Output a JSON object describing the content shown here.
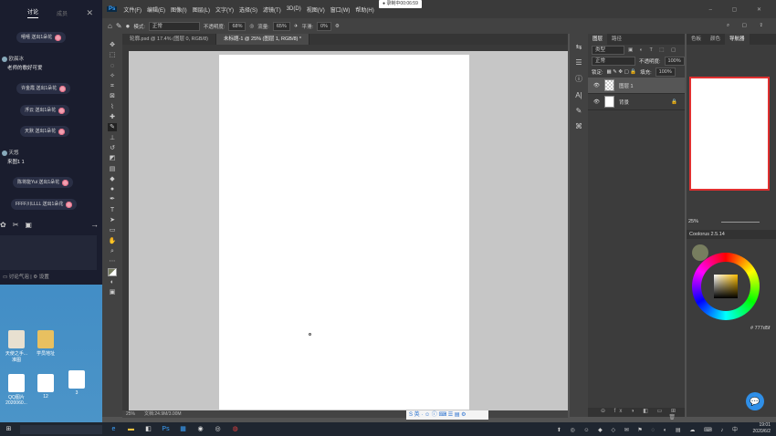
{
  "chat": {
    "tab_discuss": "讨论",
    "tab_members": "成员",
    "gifts": [
      "嘻嘻 送出1朵花",
      "许金霞 送出1朵花",
      "浮云 送出1朵花",
      "天默 送出1朵花",
      "陈将能Yui 送出1朵花",
      "FFFF川LLLL 送出1朵花"
    ],
    "msg1_user": "欧晨冰",
    "msg1_text": "老师的歌好可爱",
    "msg2_user": "天悠",
    "msg2_text": "来图1 1",
    "bottom_discuss": "讨论气泡",
    "bottom_settings": "设置"
  },
  "desktop": {
    "icons": [
      "天使之手...\n准图",
      "学员地址",
      "QQ图片\n2020060...",
      "12",
      "3"
    ]
  },
  "recording": "● 录制中00:06:59",
  "ps": {
    "logo": "Ps",
    "menu": [
      "文件(F)",
      "编辑(E)",
      "图像(I)",
      "图层(L)",
      "文字(Y)",
      "选择(S)",
      "滤镜(T)",
      "3D(D)",
      "视图(V)",
      "窗口(W)",
      "帮助(H)"
    ],
    "options": {
      "mode_label": "模式:",
      "mode_value": "正常",
      "opacity_label": "不透明度:",
      "opacity_value": "68%",
      "flow_label": "流量:",
      "flow_value": "65%",
      "smooth_label": "平滑:",
      "smooth_value": "0%"
    },
    "tabs": [
      "轮廓.psd @ 17.4% (图层 0, RGB/8)",
      "未标题-1 @ 25% (图层 1, RGB/8) *"
    ],
    "status_zoom": "25%",
    "status_doc": "文档:24.9M/3.00M",
    "layers_panel": {
      "tabs": [
        "图层",
        "路径"
      ],
      "filter": "类型",
      "blend": "正常",
      "opacity_label": "不透明度:",
      "opacity_value": "100%",
      "lock_label": "锁定:",
      "fill_label": "填充:",
      "fill_value": "100%",
      "layers": [
        "图层 1",
        "背景"
      ]
    },
    "nav_panel": {
      "tabs": [
        "色板",
        "颜色",
        "导航器"
      ],
      "zoom": "25%"
    },
    "coolorus": {
      "title": "Coolorus 2.5.14",
      "hex": "# 777d5f"
    }
  },
  "taskbar": {
    "time": "19:01",
    "date": "2020/6/2"
  }
}
